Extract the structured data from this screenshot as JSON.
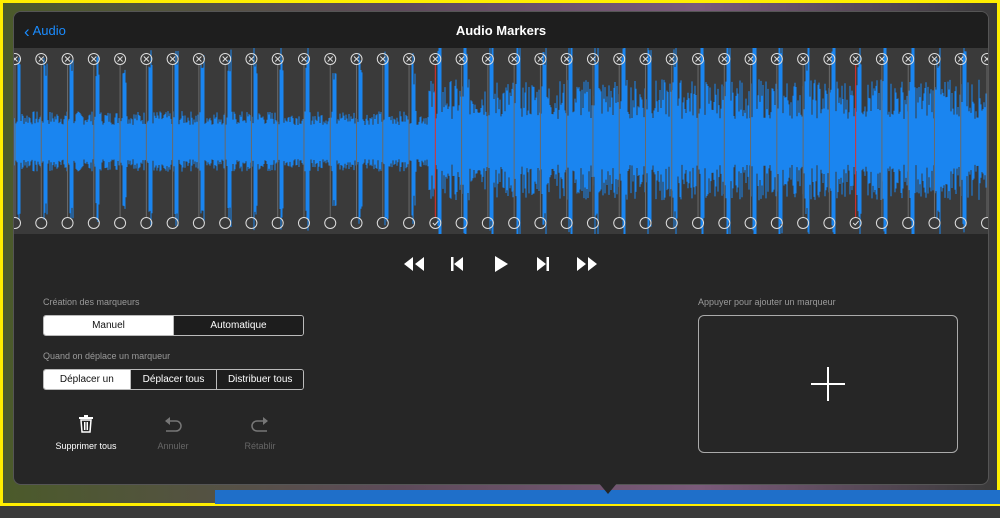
{
  "header": {
    "back_label": "Audio",
    "title": "Audio Markers"
  },
  "markers": {
    "count": 38,
    "selected": [
      16,
      32
    ]
  },
  "colors": {
    "accent": "#1a8cff",
    "waveform": "#1a85f0",
    "selected_line": "#e0302a"
  },
  "controls": {
    "creation_label": "Création des marqueurs",
    "creation_options": [
      "Manuel",
      "Automatique"
    ],
    "creation_selected": "Manuel",
    "move_label": "Quand on déplace un marqueur",
    "move_options": [
      "Déplacer un",
      "Déplacer tous",
      "Distribuer tous"
    ],
    "move_selected": "Déplacer un",
    "delete_all": "Supprimer tous",
    "undo": "Annuler",
    "redo": "Rétablir",
    "add_marker_label": "Appuyer pour ajouter un marqueur"
  },
  "transport": [
    "rewind-icon",
    "skip-back-icon",
    "play-icon",
    "skip-forward-icon",
    "fast-forward-icon"
  ]
}
